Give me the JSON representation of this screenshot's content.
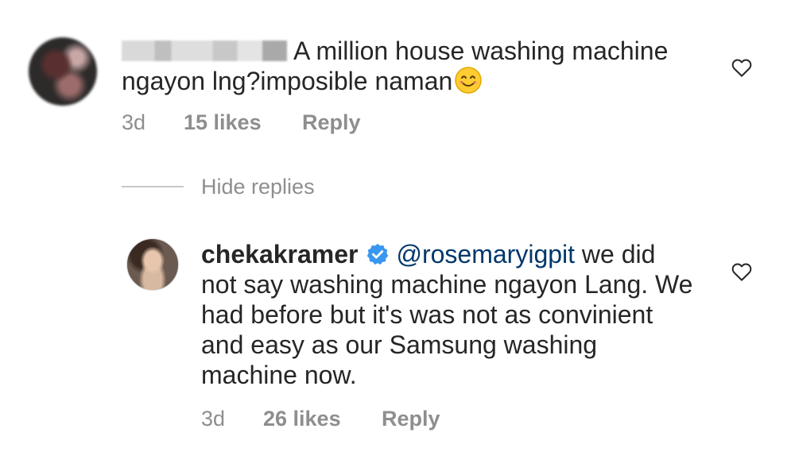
{
  "comments": [
    {
      "text": "A million house washing machine ngayon lng?imposible naman",
      "time": "3d",
      "likes": "15 likes",
      "reply": "Reply"
    },
    {
      "username": "chekakramer",
      "mention": "@rosemaryigpit",
      "text": " we did not say washing machine ngayon Lang. We had before but it's was not as convinient and easy as our Samsung washing machine now.",
      "time": "3d",
      "likes": "26 likes",
      "reply": "Reply"
    }
  ],
  "thread": {
    "hide_replies": "Hide replies"
  },
  "icons": {
    "like": "heart-outline-icon",
    "verified": "verified-badge-icon",
    "emoji": "smiling-face-emoji"
  },
  "colors": {
    "text": "#262626",
    "meta": "#8e8e8e",
    "mention": "#00376b",
    "verified": "#3897f0"
  }
}
